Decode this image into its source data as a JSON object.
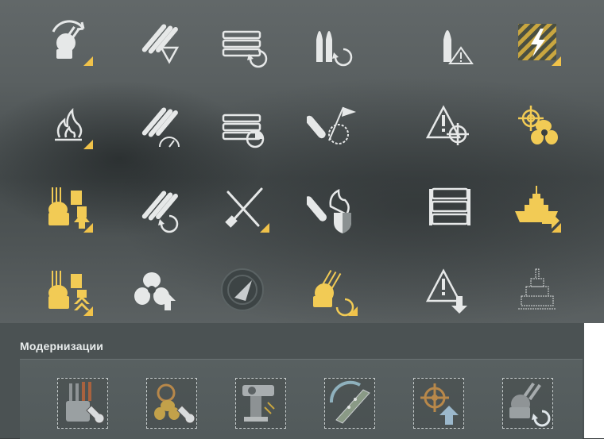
{
  "skills": [
    {
      "id": "s11",
      "icon": "turret-reload-icon",
      "variant": "white",
      "corner": true
    },
    {
      "id": "s12",
      "icon": "torpedo-triangle-icon",
      "variant": "white",
      "corner": false
    },
    {
      "id": "s13",
      "icon": "torpedo-tube-reload-icon",
      "variant": "white",
      "corner": false
    },
    {
      "id": "s14",
      "icon": "shells-reload-icon",
      "variant": "white",
      "corner": false
    },
    {
      "id": "s15",
      "icon": "shell-warning-icon",
      "variant": "white",
      "corner": false
    },
    {
      "id": "s16",
      "icon": "lightning-hazard-icon",
      "variant": "yellow",
      "corner": true
    },
    {
      "id": "s21",
      "icon": "fire-icon",
      "variant": "white",
      "corner": true
    },
    {
      "id": "s22",
      "icon": "torpedo-speed-icon",
      "variant": "white",
      "corner": false
    },
    {
      "id": "s23",
      "icon": "torpedo-tube-timer-icon",
      "variant": "white",
      "corner": false
    },
    {
      "id": "s24",
      "icon": "flag-shell-icon",
      "variant": "white",
      "corner": false
    },
    {
      "id": "s25",
      "icon": "warning-target-icon",
      "variant": "white",
      "corner": false
    },
    {
      "id": "s26",
      "icon": "helm-propeller-icon",
      "variant": "yellow",
      "corner": false
    },
    {
      "id": "s31",
      "icon": "secondary-guns-upgrade-icon",
      "variant": "yellow",
      "corner": true
    },
    {
      "id": "s32",
      "icon": "torpedo-reload-icon",
      "variant": "white",
      "corner": false
    },
    {
      "id": "s33",
      "icon": "crossed-tools-icon",
      "variant": "white",
      "corner": true
    },
    {
      "id": "s34",
      "icon": "fire-shield-icon",
      "variant": "white",
      "corner": false
    },
    {
      "id": "s35",
      "icon": "torpedo-tubes-icon",
      "variant": "white",
      "corner": false
    },
    {
      "id": "s36",
      "icon": "battleship-icon",
      "variant": "yellow",
      "corner": true
    },
    {
      "id": "s41",
      "icon": "secondary-guns-double-icon",
      "variant": "yellow",
      "corner": true
    },
    {
      "id": "s42",
      "icon": "propeller-up-icon",
      "variant": "white",
      "corner": false
    },
    {
      "id": "s43",
      "icon": "radar-compass-icon",
      "variant": "dark",
      "corner": false
    },
    {
      "id": "s44",
      "icon": "aa-gun-reload-icon",
      "variant": "yellow",
      "corner": true
    },
    {
      "id": "s45",
      "icon": "warning-down-icon",
      "variant": "white",
      "corner": false
    },
    {
      "id": "s46",
      "icon": "ship-silhouette-icon",
      "variant": "white",
      "corner": false
    }
  ],
  "colors": {
    "white": "#e6e8e8",
    "yellow": "#f2cb55",
    "dark": "#3b4243",
    "accent": "#f0c24a"
  },
  "modernizations": {
    "title": "Модернизации",
    "slots": [
      {
        "icon": "main-battery-mod-icon"
      },
      {
        "icon": "propulsion-mod-icon"
      },
      {
        "icon": "aiming-system-mod-icon"
      },
      {
        "icon": "steering-gears-mod-icon"
      },
      {
        "icon": "steering-up-mod-icon"
      },
      {
        "icon": "turret-reload-mod-icon"
      }
    ]
  }
}
